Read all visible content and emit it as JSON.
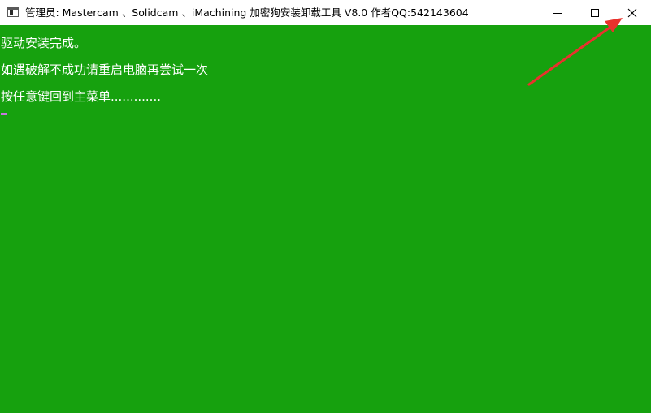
{
  "window": {
    "title": "管理员:  Mastercam 、Solidcam  、iMachining 加密狗安装卸载工具 V8.0  作者QQ:542143604",
    "icon": "console-window-icon"
  },
  "controls": {
    "minimize_icon": "minimize-icon",
    "maximize_icon": "maximize-icon",
    "close_icon": "close-icon"
  },
  "console": {
    "background": "#16a10e",
    "text_color": "#ffffff",
    "lines": [
      "驱动安装完成。",
      "如遇破解不成功请重启电脑再尝试一次",
      "按任意键回到主菜单............."
    ],
    "cursor_color": "#c678dd"
  },
  "annotation": {
    "type": "arrow",
    "color": "#e8322d",
    "points_to": "close-button"
  }
}
